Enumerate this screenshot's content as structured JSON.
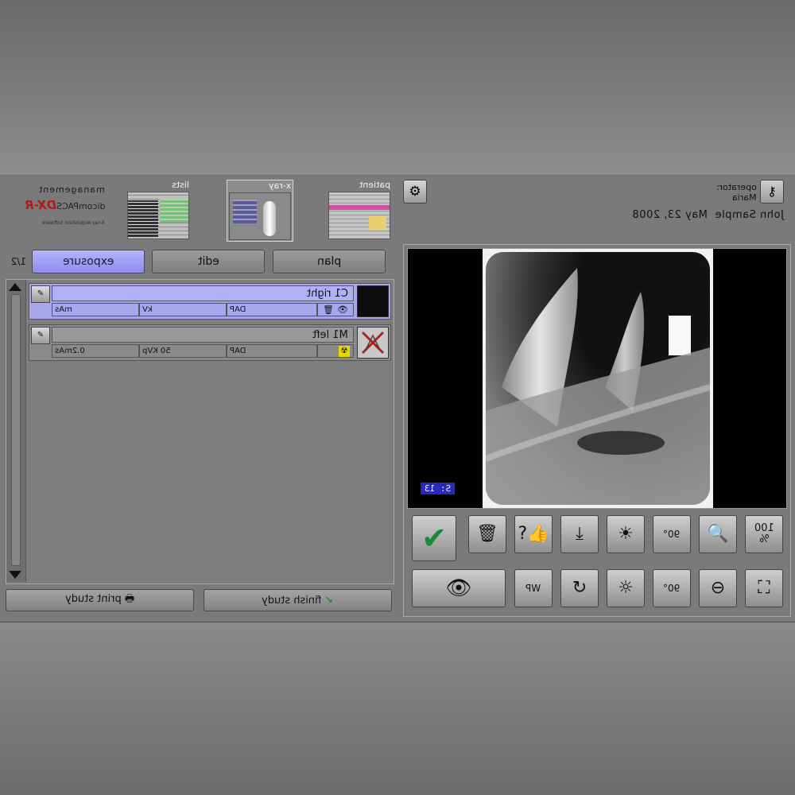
{
  "header": {
    "brand": {
      "management_label": "management",
      "logo_prefix": "dicomPACS",
      "logo_mark": "DX-R",
      "tagline": "X-ray Acquisition Software"
    },
    "nav_tabs": [
      {
        "label": "lists"
      },
      {
        "label": "x-ray"
      },
      {
        "label": "patient"
      }
    ],
    "operator_label": "operator:",
    "operator_name": "Maria",
    "patient_name": "John Sample",
    "study_date": "May 23, 2008"
  },
  "tabs": {
    "page_indicator": "1/2",
    "exposure": "exposure",
    "edit": "edit",
    "plan": "plan"
  },
  "exposures": [
    {
      "name": "C1 right",
      "mas": "mAs",
      "kv": "kV",
      "dap": "DAP"
    },
    {
      "name": "M1 left",
      "mas": "0.2mAs",
      "kv": "50 KVp",
      "dap": "DAP"
    }
  ],
  "buttons": {
    "print_study": "print study",
    "finish_study": "finish study"
  },
  "viewer": {
    "counter": "S: 13"
  },
  "tools": {
    "zoom_100": "100",
    "zoom_pct": "%",
    "rotate_90": "90°",
    "wp_label": "WP"
  },
  "icons": [
    "gear-icon",
    "key-icon",
    "pencil-icon",
    "eye-icon",
    "trash-icon",
    "radiation-icon",
    "checkmark-icon",
    "zoom-in-icon",
    "zoom-out-icon",
    "brightness-up-icon",
    "brightness-down-icon",
    "rotate-icon",
    "fit-screen-icon",
    "print-icon"
  ]
}
